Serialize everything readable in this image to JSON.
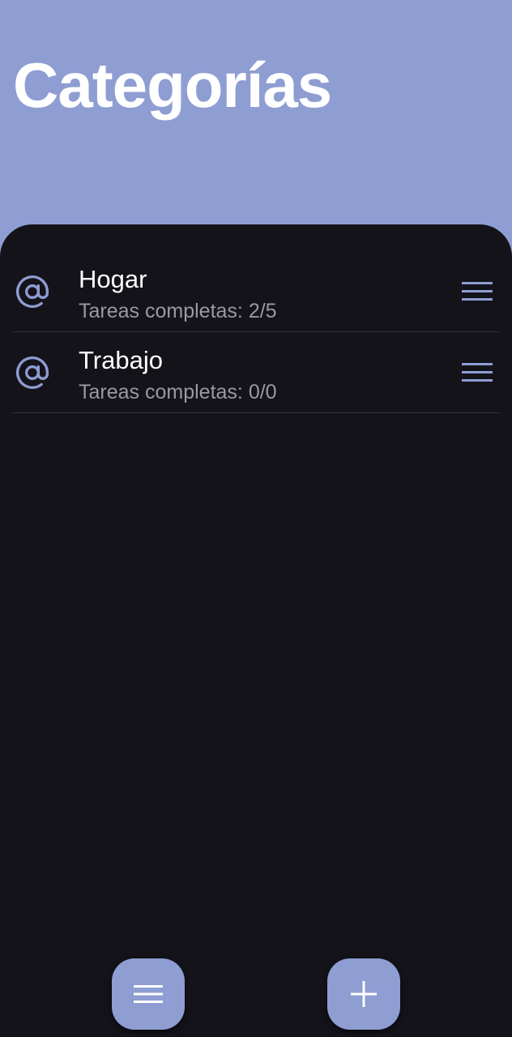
{
  "header": {
    "title": "Categorías"
  },
  "categories": [
    {
      "name": "Hogar",
      "subtitle": "Tareas completas: 2/5",
      "completed": 2,
      "total": 5,
      "icon": "at-sign-icon"
    },
    {
      "name": "Trabajo",
      "subtitle": "Tareas completas: 0/0",
      "completed": 0,
      "total": 0,
      "icon": "at-sign-icon"
    }
  ],
  "bottom_bar": {
    "menu_icon": "hamburger-menu-icon",
    "add_icon": "plus-icon"
  },
  "colors": {
    "accent": "#8e9dd2",
    "background": "#141319",
    "text_primary": "#ffffff",
    "text_secondary": "#9a99a1",
    "divider": "#34333a"
  }
}
